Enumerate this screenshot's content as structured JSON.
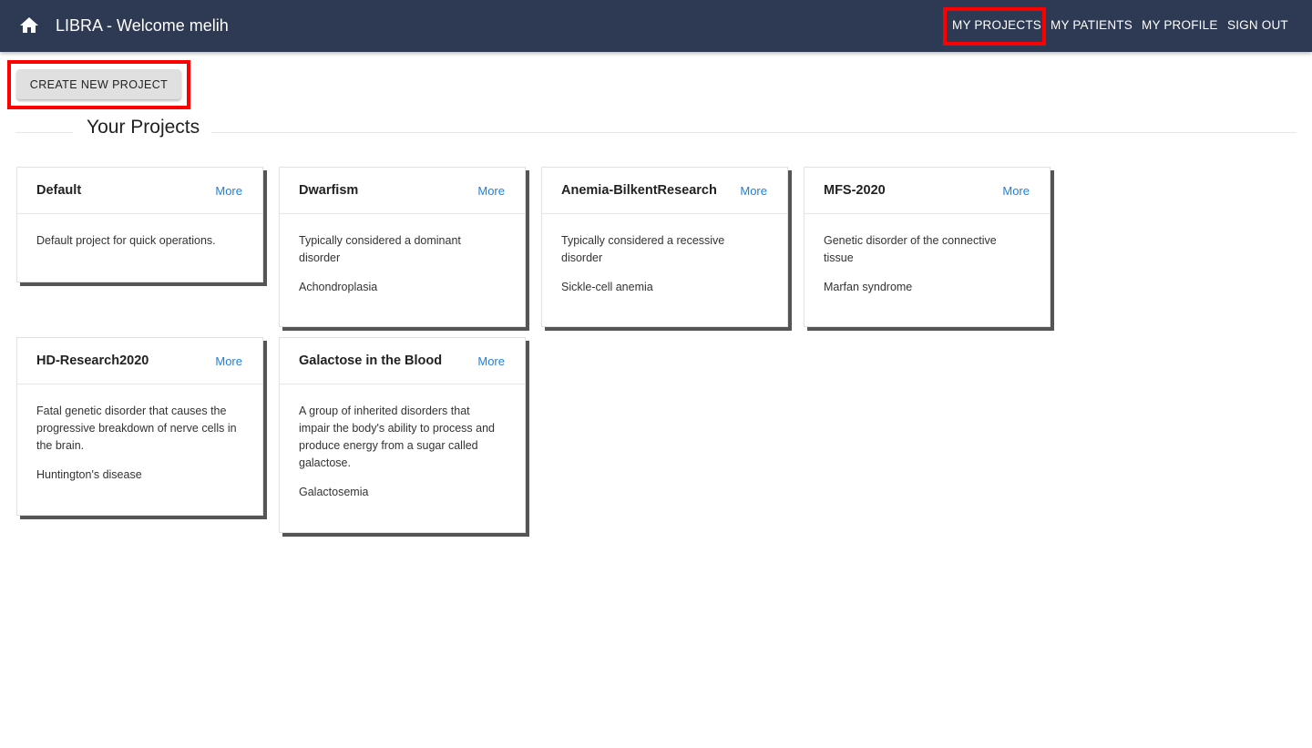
{
  "header": {
    "title": "LIBRA - Welcome melih",
    "home_icon": "home-icon",
    "nav": [
      {
        "label": "MY PROJECTS",
        "highlighted": true
      },
      {
        "label": "MY PATIENTS"
      },
      {
        "label": "MY PROFILE"
      },
      {
        "label": "SIGN OUT"
      }
    ]
  },
  "actions": {
    "create_label": "CREATE NEW PROJECT"
  },
  "section": {
    "title": "Your Projects"
  },
  "colors": {
    "topbar": "#2e3a53",
    "link": "#1e7fdc",
    "highlight": "#ff0000"
  },
  "projects": [
    {
      "title": "Default",
      "more": "More",
      "description": "Default project for quick operations.",
      "disease": ""
    },
    {
      "title": "Dwarfism",
      "more": "More",
      "description": "Typically considered a dominant disorder",
      "disease": "Achondroplasia"
    },
    {
      "title": "Anemia-BilkentResearch",
      "more": "More",
      "description": "Typically considered a recessive disorder",
      "disease": "Sickle-cell anemia"
    },
    {
      "title": "MFS-2020",
      "more": "More",
      "description": "Genetic disorder of the connective tissue",
      "disease": "Marfan syndrome"
    },
    {
      "title": "HD-Research2020",
      "more": "More",
      "description": "Fatal genetic disorder that causes the progressive breakdown of nerve cells in the brain.",
      "disease": "Huntington's disease"
    },
    {
      "title": "Galactose in the Blood",
      "more": "More",
      "description": "A group of inherited disorders that impair the body's ability to process and produce energy from a sugar called galactose.",
      "disease": "Galactosemia"
    }
  ]
}
